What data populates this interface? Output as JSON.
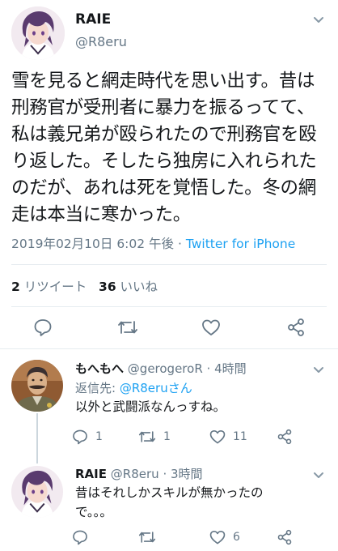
{
  "tweet": {
    "author_name": "RAIE",
    "author_handle": "@R8eru",
    "text": "雪を見ると網走時代を思い出す。昔は刑務官が受刑者に暴力を振るってて、私は義兄弟が殴られたので刑務官を殴り返した。そしたら独房に入れられたのだが、あれは死を覚悟した。冬の網走は本当に寒かった。",
    "timestamp": "2019年02月10日 6:02 午後",
    "separator": " · ",
    "source": "Twitter for iPhone",
    "retweets_count": "2",
    "retweets_label": "リツイート",
    "likes_count": "36",
    "likes_label": "いいね"
  },
  "replies": [
    {
      "name": "もへもへ",
      "handle": "@gerogeroR",
      "time": "· 4時間",
      "reply_to_label": "返信先: ",
      "reply_to_mention": "@R8eruさん",
      "text": "以外と武闘派なんっすね。",
      "reply_count": "1",
      "retweet_count": "1",
      "like_count": "11"
    },
    {
      "name": "RAIE",
      "handle": "@R8eru",
      "time": "· 3時間",
      "text": "昔はそれしかスキルが無かったので。。。",
      "reply_count": "",
      "retweet_count": "",
      "like_count": "6"
    }
  ],
  "icons": {
    "reply": "reply-icon",
    "retweet": "retweet-icon",
    "like": "heart-icon",
    "share": "share-icon",
    "more": "chevron-down-icon"
  },
  "colors": {
    "link": "#1da1f2",
    "secondary_text": "#657786",
    "divider": "#e6ecf0"
  }
}
